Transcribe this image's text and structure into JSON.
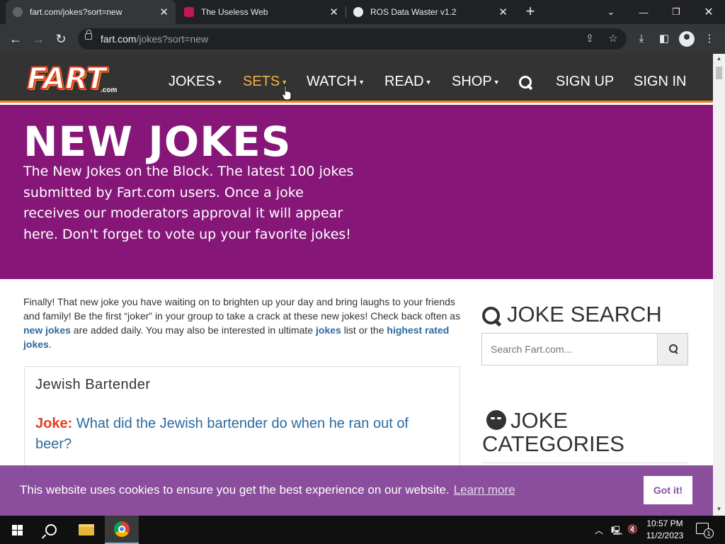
{
  "browser": {
    "tabs": [
      {
        "title": "fart.com/jokes?sort=new",
        "favicon_color": "#5f6368",
        "active": true
      },
      {
        "title": "The Useless Web",
        "favicon_color": "#c2185b",
        "active": false
      },
      {
        "title": "ROS Data Waster v1.2",
        "favicon_color": "#e8eaed",
        "active": false
      }
    ],
    "url_host": "fart.com",
    "url_path": "/jokes?sort=new"
  },
  "site": {
    "logo": "FART",
    "logo_suffix": ".com",
    "nav": [
      {
        "label": "JOKES",
        "hover": false
      },
      {
        "label": "SETS",
        "hover": true
      },
      {
        "label": "WATCH",
        "hover": false
      },
      {
        "label": "READ",
        "hover": false
      },
      {
        "label": "SHOP",
        "hover": false
      }
    ],
    "sign_up": "SIGN UP",
    "sign_in": "SIGN IN",
    "accent_color": "#e8861e",
    "hero_color": "#861779"
  },
  "hero": {
    "title": "NEW JOKES",
    "description": "The New Jokes on the Block. The latest 100 jokes submitted by Fart.com users. Once a joke receives our moderators approval it will appear here. Don't forget to vote up your favorite jokes!"
  },
  "intro": {
    "text_1": "Finally! That new joke you have waiting on to brighten up your day and bring laughs to your friends and family! Be the first “joker” in your group to take a crack at these new jokes! Check back often as ",
    "link_new": "new jokes",
    "text_2": " are added daily.  You may also be interested in ultimate ",
    "link_jokes": "jokes",
    "text_3": " list or the ",
    "link_highest": "highest rated jokes",
    "text_4": "."
  },
  "joke": {
    "title": "Jewish Bartender",
    "label": "Joke:",
    "text": "What did the Jewish bartender do when he ran out of beer?"
  },
  "sidebar": {
    "search_title": "JOKE SEARCH",
    "search_placeholder": "Search Fart.com...",
    "categories_title": "JOKE CATEGORIES"
  },
  "cookie": {
    "message": "This website uses cookies to ensure you get the best experience on our website.",
    "link": "Learn more",
    "button": "Got it!"
  },
  "taskbar": {
    "time": "10:57 PM",
    "date": "11/2/2023",
    "notifications": "1"
  }
}
